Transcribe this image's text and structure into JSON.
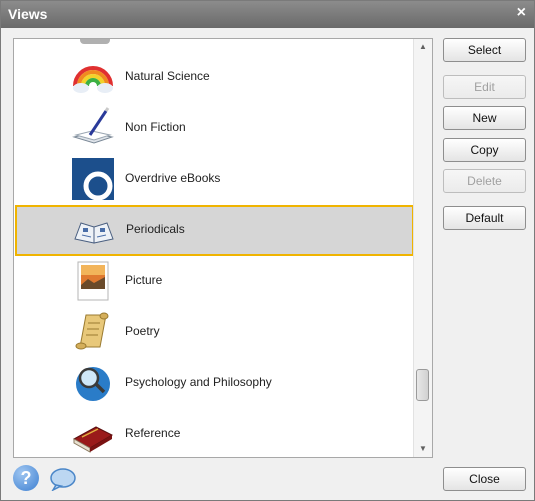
{
  "window": {
    "title": "Views",
    "close_glyph": "×"
  },
  "list": {
    "items": [
      {
        "label": "Natural Science",
        "icon": "rainbow-icon"
      },
      {
        "label": "Non Fiction",
        "icon": "book-pen-icon"
      },
      {
        "label": "Overdrive eBooks",
        "icon": "overdrive-logo-icon"
      },
      {
        "label": "Periodicals",
        "icon": "open-book-icon",
        "selected": true
      },
      {
        "label": "Picture",
        "icon": "photo-icon"
      },
      {
        "label": "Poetry",
        "icon": "scroll-icon"
      },
      {
        "label": "Psychology and Philosophy",
        "icon": "globe-magnifier-icon"
      },
      {
        "label": "Reference",
        "icon": "red-book-icon"
      }
    ],
    "scroll_position": 0.88
  },
  "buttons": {
    "select": "Select",
    "edit": "Edit",
    "new": "New",
    "copy": "Copy",
    "delete": "Delete",
    "default": "Default",
    "close": "Close"
  },
  "footer": {
    "help_glyph": "?"
  },
  "colors": {
    "selection_border": "#f0b400",
    "selection_fill": "#d6d6d6",
    "titlebar": "#7a7a7a"
  }
}
